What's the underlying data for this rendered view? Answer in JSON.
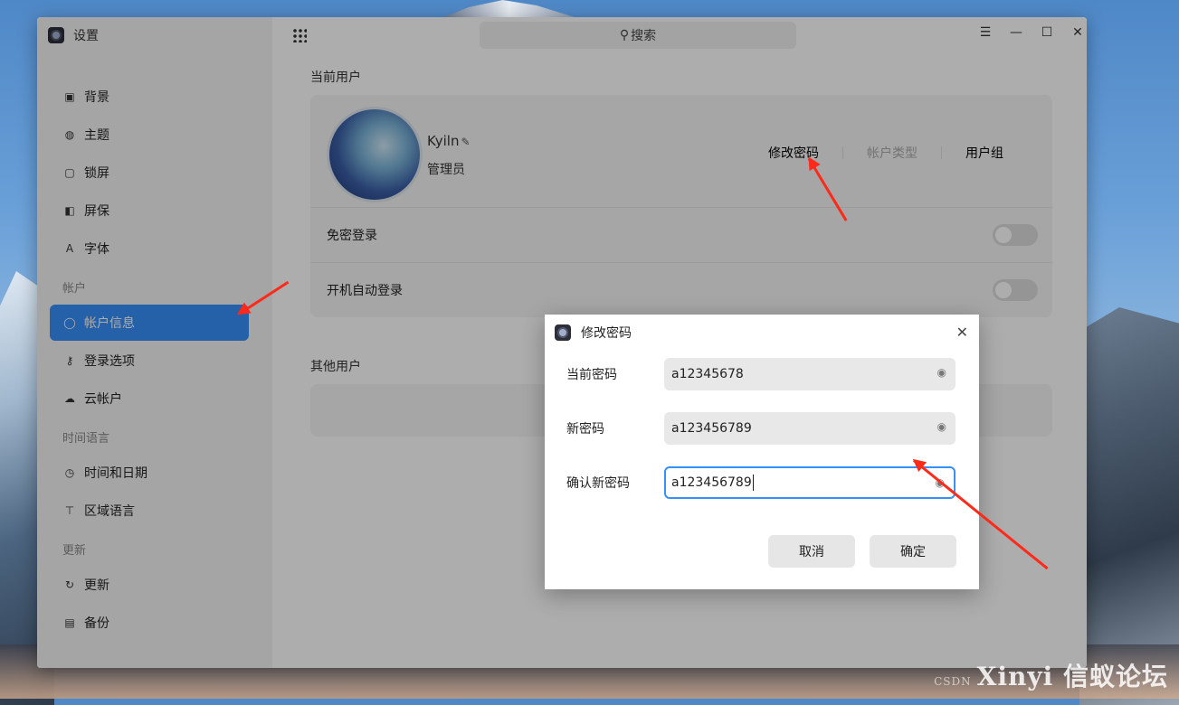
{
  "app": {
    "title": "设置"
  },
  "sidebar": {
    "items": [
      {
        "label": "背景",
        "icon": "image-icon"
      },
      {
        "label": "主题",
        "icon": "palette-icon"
      },
      {
        "label": "锁屏",
        "icon": "lock-screen-icon"
      },
      {
        "label": "屏保",
        "icon": "screensaver-icon"
      },
      {
        "label": "字体",
        "icon": "font-icon"
      }
    ],
    "section_account": "帐户",
    "account_items": [
      {
        "label": "帐户信息",
        "icon": "user-icon",
        "active": true
      },
      {
        "label": "登录选项",
        "icon": "key-icon"
      },
      {
        "label": "云帐户",
        "icon": "cloud-icon"
      }
    ],
    "section_time": "时间语言",
    "time_items": [
      {
        "label": "时间和日期",
        "icon": "clock-icon"
      },
      {
        "label": "区域语言",
        "icon": "region-icon"
      }
    ],
    "section_update": "更新",
    "update_items": [
      {
        "label": "更新",
        "icon": "refresh-icon"
      },
      {
        "label": "备份",
        "icon": "backup-icon"
      }
    ]
  },
  "search": {
    "placeholder": "搜索"
  },
  "main": {
    "current_user_title": "当前用户",
    "username": "Kyiln",
    "usertype": "管理员",
    "actions": {
      "change_password": "修改密码",
      "account_type": "帐户类型",
      "user_group": "用户组"
    },
    "passwordless_login": "免密登录",
    "auto_login": "开机自动登录",
    "other_users_title": "其他用户"
  },
  "dialog": {
    "title": "修改密码",
    "current_password_label": "当前密码",
    "current_password_value": "a12345678",
    "new_password_label": "新密码",
    "new_password_value": "a123456789",
    "confirm_password_label": "确认新密码",
    "confirm_password_value": "a123456789",
    "cancel_label": "取消",
    "ok_label": "确定"
  },
  "watermark": {
    "main": "Xinyi 信蚁论坛",
    "sub": "CSDN"
  },
  "colors": {
    "accent": "#3790fa",
    "annotation_arrow": "#ff2a1a"
  }
}
